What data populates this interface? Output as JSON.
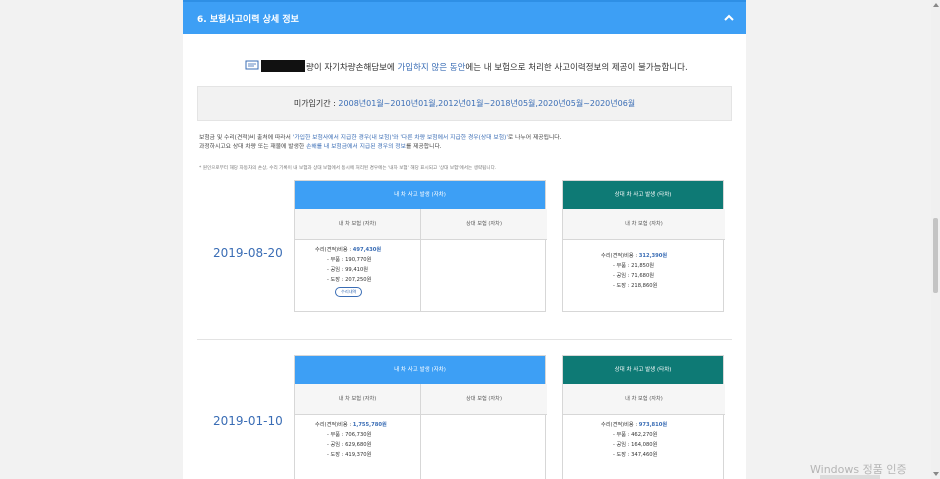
{
  "panel": {
    "title": "6. 보험사고이력 상세 정보",
    "collapse_icon": "chevron-up-icon"
  },
  "notice": {
    "prefix": "",
    "text_a": "량이 자기차량손해담보에 ",
    "text_hl": "가입하지 않은 동안",
    "text_b": "에는 내 보험으로 처리한 사고이력정보의 제공이 불가능합니다."
  },
  "period": {
    "label": "미가입기간 : ",
    "value": "2008년01월~2010년01월,2012년01월~2018년05월,2020년05월~2020년06월"
  },
  "description": {
    "line1_a": "보험금 및 수리(견적)비 출처에 따라서 ",
    "line1_hl": "'가입한 보험사에서 지급한 경우(내 보험)'와 '다른 차량 보험에서 지급한 경우(상대 보험)'",
    "line1_b": "로 나누어 제공됩니다.",
    "line2_a": "과정하시고요 상대 차량 또는 재물에 발생한 ",
    "line2_hl": "손해를 내 보험금에서 지급된 경우의 정보",
    "line2_b": "를 제공합니다."
  },
  "footnote": "* 원인으로부터 해당 자동차의 손상, 수리 기록이 내 보험과 상대 보험에서 동시에 처리된 경우에는 '내차 보험' 해당 표시되고 '상대 보험'에서는 생략됩니다.",
  "records": [
    {
      "date": "2019-08-20",
      "mine_header": "내 차 사고 발생 (자차)",
      "mine_col1": "내 차 보험 (자차)",
      "mine_col2": "상대 보험 (자차)",
      "mine_repair_label": "수리(견적)비용 : ",
      "mine_repair": "497,430원",
      "mine_parts": "- 부품 : 190,770원",
      "mine_labor": "- 공임 : 99,410원",
      "mine_paint": "- 도장 : 207,250원",
      "detail_button": "수리내역",
      "other_header": "상대 차 사고 발생 (타차)",
      "other_col": "내 차 보험 (자차)",
      "other_repair_label": "수리(견적)비용 : ",
      "other_repair": "312,390원",
      "other_parts": "- 부품 : 21,850원",
      "other_labor": "- 공임 : 71,680원",
      "other_paint": "- 도장 : 218,860원"
    },
    {
      "date": "2019-01-10",
      "mine_header": "내 차 사고 발생 (자차)",
      "mine_col1": "내 차 보험 (자차)",
      "mine_col2": "상대 보험 (자차)",
      "mine_repair_label": "수리(견적)비용 : ",
      "mine_repair": "1,755,780원",
      "mine_parts": "- 부품 : 706,730원",
      "mine_labor": "- 공임 : 629,680원",
      "mine_paint": "- 도장 : 419,370원",
      "other_header": "상대 차 사고 발생 (타차)",
      "other_col": "내 차 보험 (자차)",
      "other_repair_label": "수리(견적)비용 : ",
      "other_repair": "973,810원",
      "other_parts": "- 부품 : 462,270원",
      "other_labor": "- 공임 : 164,080원",
      "other_paint": "- 도장 : 347,460원"
    }
  ],
  "colors": {
    "header_blue": "#3d9ff5",
    "teal": "#0e7a75",
    "link_blue": "#3a6db5"
  },
  "watermark": "Windows 정품 인증"
}
